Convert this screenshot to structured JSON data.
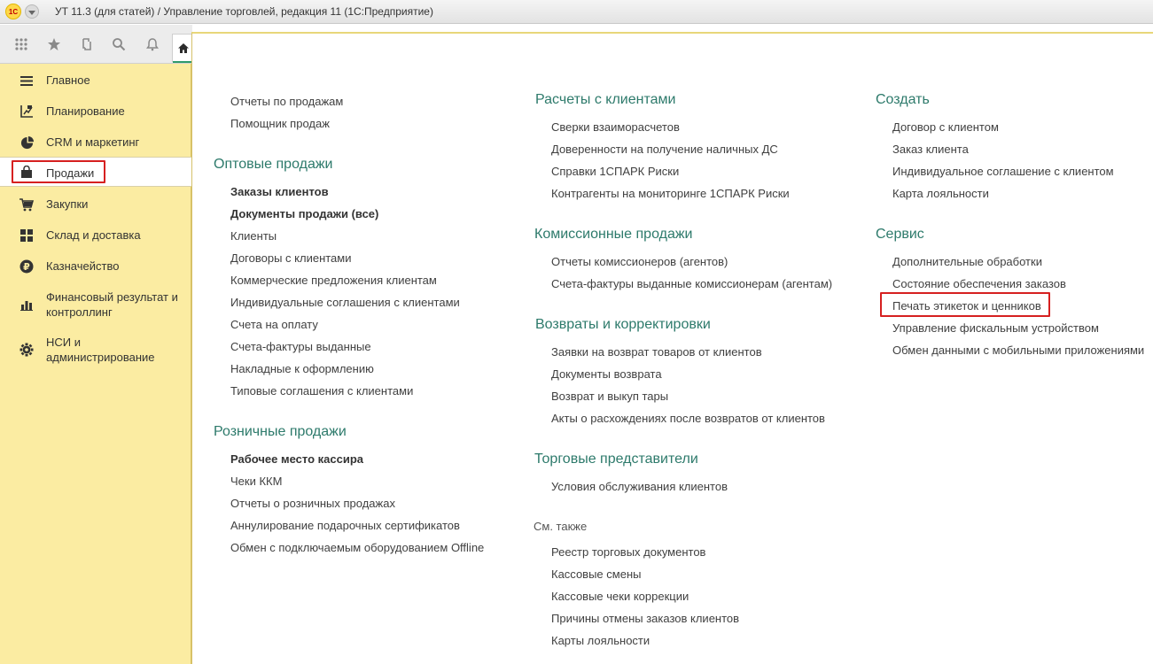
{
  "app": {
    "logo_text": "1С",
    "title": "УТ 11.3 (для статей) / Управление торговлей, редакция 11  (1С:Предприятие)"
  },
  "toolbar": {
    "icons": [
      "apps-grid-icon",
      "favorites-star-icon",
      "history-icon",
      "search-icon",
      "notifications-bell-icon",
      "home-icon"
    ]
  },
  "sidebar": {
    "items": [
      {
        "label": "Главное",
        "icon": "menu-lines-icon"
      },
      {
        "label": "Планирование",
        "icon": "planning-icon"
      },
      {
        "label": "CRM и маркетинг",
        "icon": "pie-chart-icon"
      },
      {
        "label": "Продажи",
        "icon": "shopping-bag-icon",
        "active": true
      },
      {
        "label": "Закупки",
        "icon": "cart-icon"
      },
      {
        "label": "Склад и доставка",
        "icon": "warehouse-grid-icon"
      },
      {
        "label": "Казначейство",
        "icon": "ruble-icon"
      },
      {
        "label": "Финансовый результат и контроллинг",
        "icon": "bar-chart-icon"
      },
      {
        "label": "НСИ и администрирование",
        "icon": "gear-icon"
      }
    ]
  },
  "columns": {
    "col1": {
      "top_links": [
        "Отчеты по продажам",
        "Помощник продаж"
      ],
      "wholesale": {
        "title": "Оптовые продажи",
        "links": [
          {
            "label": "Заказы клиентов",
            "bold": true
          },
          {
            "label": "Документы продажи (все)",
            "bold": true
          },
          {
            "label": "Клиенты"
          },
          {
            "label": "Договоры с клиентами"
          },
          {
            "label": "Коммерческие предложения клиентам"
          },
          {
            "label": "Индивидуальные соглашения с клиентами"
          },
          {
            "label": "Счета на оплату"
          },
          {
            "label": "Счета-фактуры выданные"
          },
          {
            "label": "Накладные к оформлению"
          },
          {
            "label": "Типовые соглашения с клиентами"
          }
        ]
      },
      "retail": {
        "title": "Розничные продажи",
        "links": [
          {
            "label": "Рабочее место кассира",
            "bold": true
          },
          {
            "label": "Чеки ККМ"
          },
          {
            "label": "Отчеты о розничных продажах"
          },
          {
            "label": "Аннулирование подарочных сертификатов"
          },
          {
            "label": "Обмен с подключаемым оборудованием Offline"
          }
        ]
      }
    },
    "col2": {
      "settlements": {
        "title": "Расчеты с клиентами",
        "links": [
          "Сверки взаиморасчетов",
          "Доверенности на получение наличных ДС",
          "Справки 1СПАРК Риски",
          "Контрагенты на мониторинге 1СПАРК Риски"
        ]
      },
      "commission": {
        "title": "Комиссионные продажи",
        "links": [
          "Отчеты комиссионеров (агентов)",
          "Счета-фактуры выданные комиссионерам (агентам)"
        ]
      },
      "returns": {
        "title": "Возвраты и корректировки",
        "links": [
          "Заявки на возврат товаров от клиентов",
          "Документы возврата",
          "Возврат и выкуп тары",
          "Акты о расхождениях после возвратов от клиентов"
        ]
      },
      "reps": {
        "title": "Торговые представители",
        "links": [
          "Условия обслуживания клиентов"
        ]
      },
      "see_also": {
        "title": "См. также",
        "links": [
          "Реестр торговых документов",
          "Кассовые смены",
          "Кассовые чеки коррекции",
          "Причины отмены заказов клиентов",
          "Карты лояльности"
        ]
      }
    },
    "col3": {
      "create": {
        "title": "Создать",
        "links": [
          "Договор с клиентом",
          "Заказ клиента",
          "Индивидуальное соглашение с клиентом",
          "Карта лояльности"
        ]
      },
      "service": {
        "title": "Сервис",
        "links": [
          "Дополнительные обработки",
          "Состояние обеспечения заказов",
          "Печать этикеток и ценников",
          "Управление фискальным устройством",
          "Обмен данными с мобильными приложениями"
        ]
      }
    }
  },
  "colors": {
    "sidebar_bg": "#fbeca2",
    "section_title": "#2d7a6b",
    "highlight_box": "#d62020"
  }
}
